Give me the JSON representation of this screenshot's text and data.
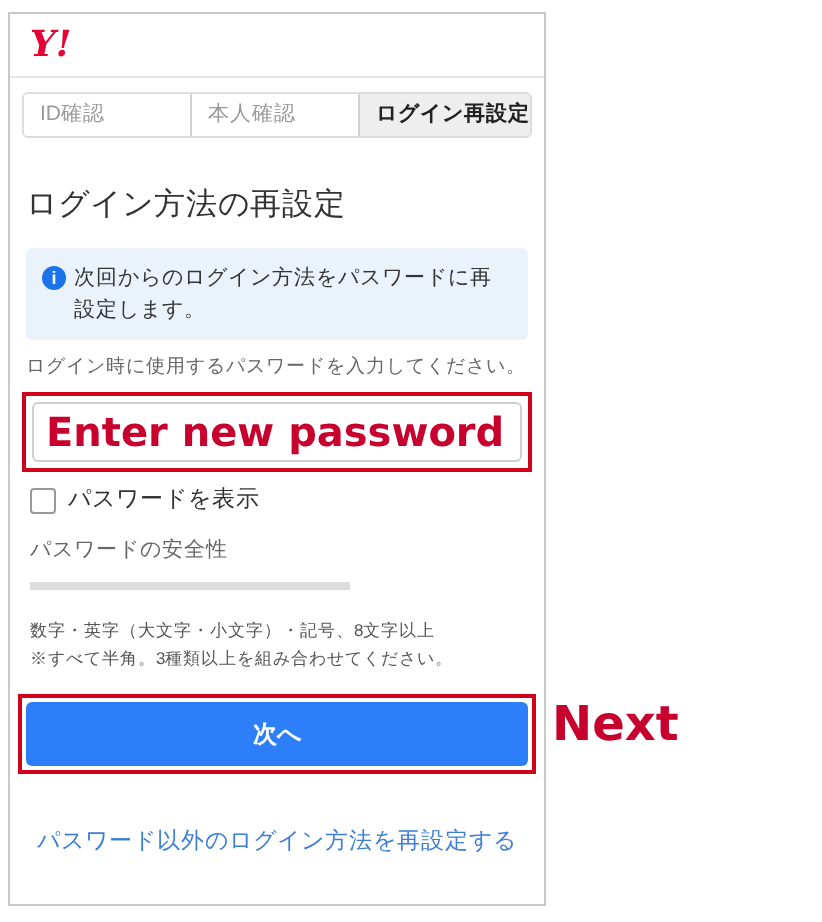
{
  "logo": "Y!",
  "steps": [
    {
      "label": "ID確認",
      "selected": false
    },
    {
      "label": "本人確認",
      "selected": false
    },
    {
      "label": "ログイン再設定",
      "selected": true
    }
  ],
  "title": "ログイン方法の再設定",
  "info": {
    "icon": "i",
    "text": "次回からのログイン方法をパスワードに再設定します。"
  },
  "hint": "ログイン時に使用するパスワードを入力してください。",
  "password_field": {
    "value": "Enter new password",
    "highlighted": true
  },
  "show_password": {
    "label": "パスワードを表示",
    "checked": false
  },
  "strength": {
    "label": "パスワードの安全性",
    "level": 0
  },
  "rules": [
    "数字・英字（大文字・小文字）・記号、8文字以上",
    "※すべて半角。3種類以上を組み合わせてください。"
  ],
  "next_button": {
    "label": "次へ",
    "highlighted": true,
    "annotation": "Next"
  },
  "alt_link": "パスワード以外のログイン方法を再設定する"
}
